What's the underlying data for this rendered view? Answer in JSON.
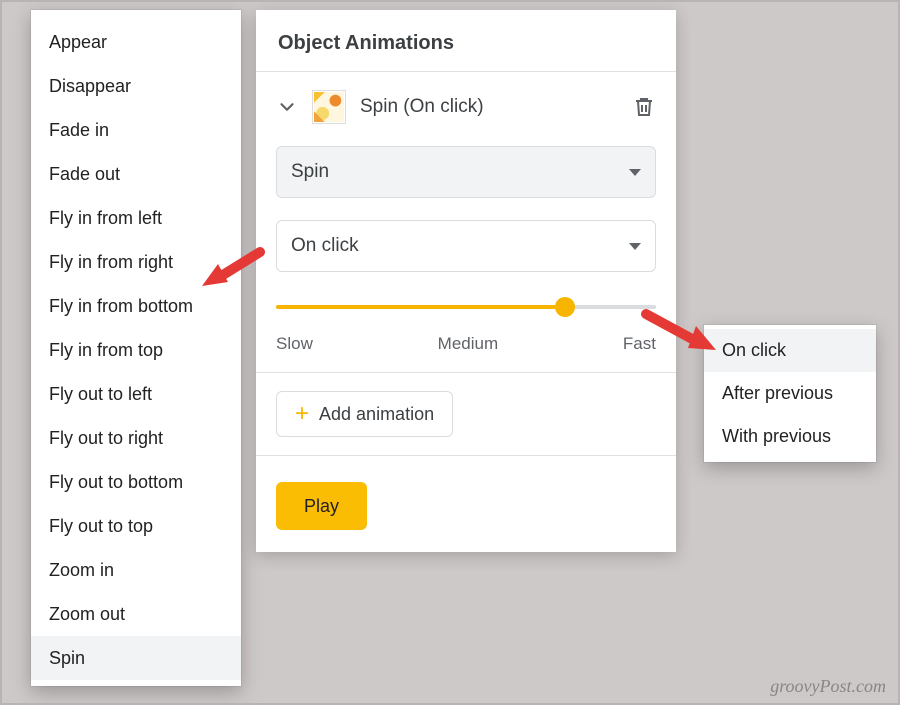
{
  "animationList": {
    "items": [
      "Appear",
      "Disappear",
      "Fade in",
      "Fade out",
      "Fly in from left",
      "Fly in from right",
      "Fly in from bottom",
      "Fly in from top",
      "Fly out to left",
      "Fly out to right",
      "Fly out to bottom",
      "Fly out to top",
      "Zoom in",
      "Zoom out",
      "Spin"
    ],
    "selected": "Spin"
  },
  "panel": {
    "title": "Object Animations",
    "currentAnimationSummary": "Spin  (On click)",
    "animationType": {
      "selected": "Spin"
    },
    "trigger": {
      "selected": "On click"
    },
    "speed": {
      "labels": {
        "slow": "Slow",
        "medium": "Medium",
        "fast": "Fast"
      },
      "percent": 76
    },
    "addAnimationLabel": "Add animation",
    "playLabel": "Play"
  },
  "triggerPopup": {
    "items": [
      "On click",
      "After previous",
      "With previous"
    ],
    "selected": "On click"
  },
  "watermark": "groovyPost.com",
  "colors": {
    "accent": "#f7b500",
    "playButton": "#fbbc04",
    "arrow": "#e53935"
  }
}
